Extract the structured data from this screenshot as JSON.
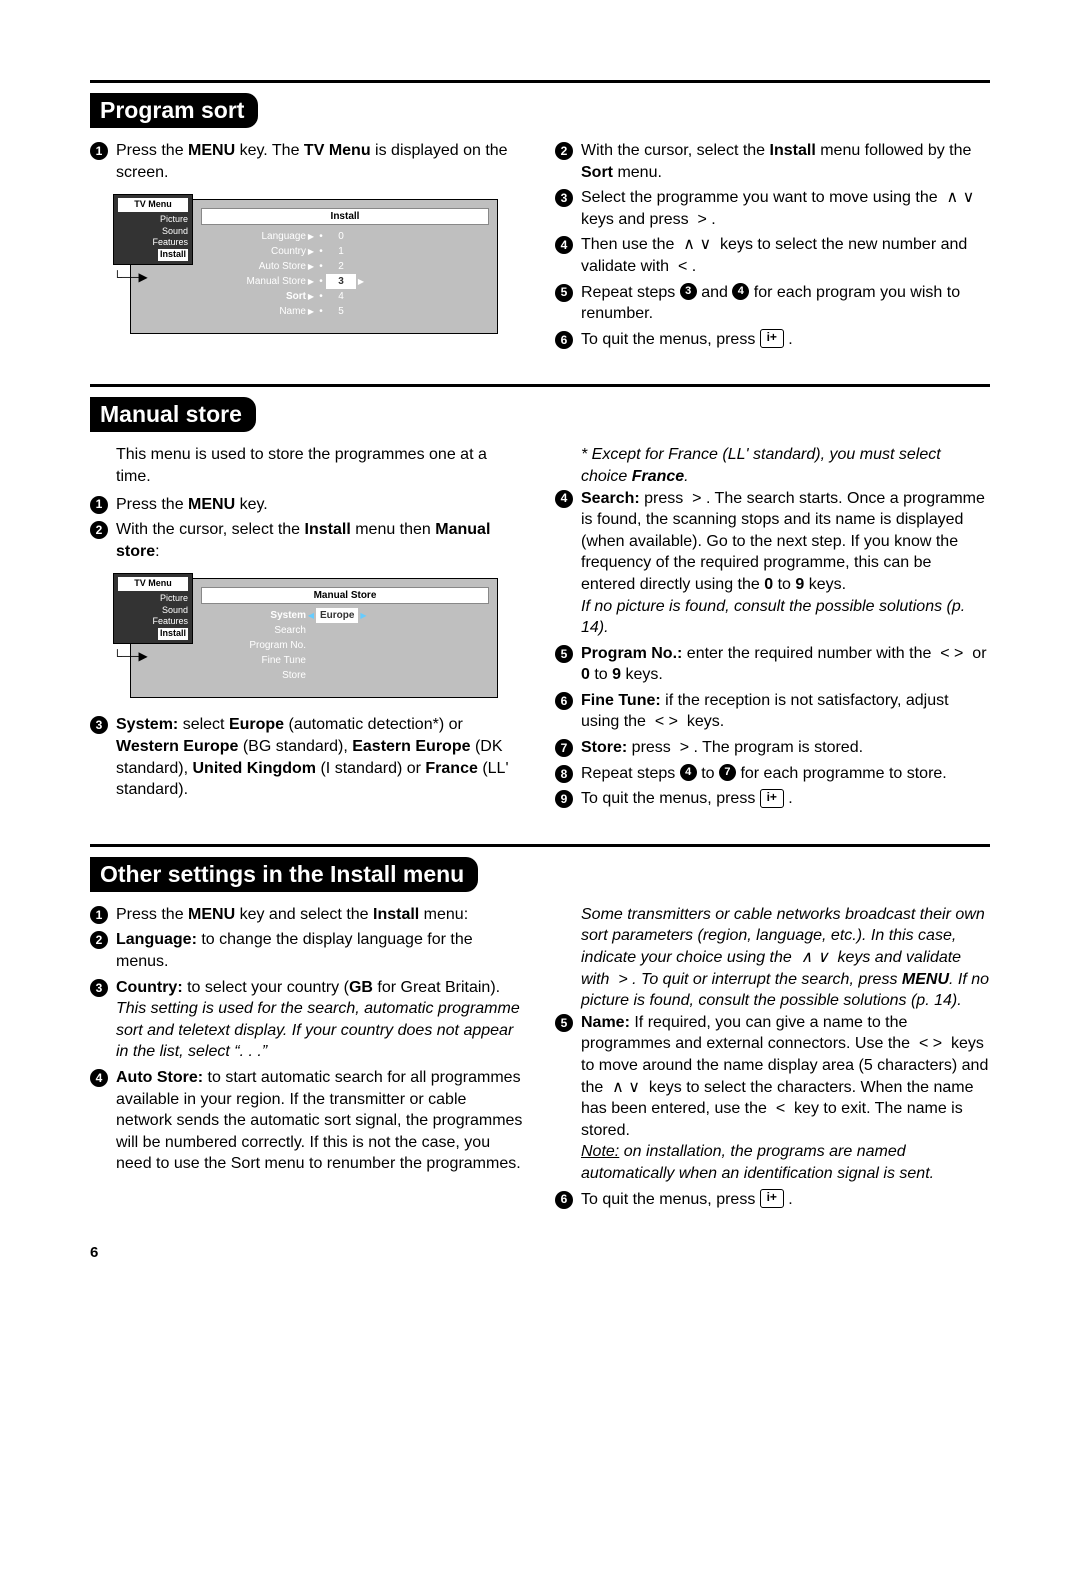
{
  "page_number": "6",
  "section1": {
    "title": "Program sort",
    "left": {
      "s1": "Press the <b>MENU</b> key. The <b>TV Menu</b> is displayed on the screen."
    },
    "right": {
      "s2": "With the cursor, select the <b>Install</b> menu followed by the <b>Sort</b> menu.",
      "s3": "Select the programme you want to move using the &nbsp;∧ ∨&nbsp; keys and press &nbsp;>&nbsp;.",
      "s4": "Then use the &nbsp;∧ ∨&nbsp; keys to select the new number and validate with &nbsp;<&nbsp;.",
      "s5_a": "Repeat steps ",
      "s5_b": " and ",
      "s5_c": " for each program you wish to renumber.",
      "s6_a": "To quit the menus, press ",
      "s6_key": "i+",
      "s6_b": "."
    },
    "diagram": {
      "left_tab_hdr": "TV Menu",
      "left_items": [
        "Picture",
        "Sound",
        "Features"
      ],
      "left_hl": "Install",
      "panel_hdr": "Install",
      "rows": [
        {
          "lab": "Language",
          "val": "0"
        },
        {
          "lab": "Country",
          "val": "1"
        },
        {
          "lab": "Auto Store",
          "val": "2"
        },
        {
          "lab": "Manual Store",
          "val": "3",
          "hl": true
        },
        {
          "lab": "Sort",
          "val": "4",
          "bold": true
        },
        {
          "lab": "Name",
          "val": "5"
        }
      ]
    }
  },
  "section2": {
    "title": "Manual store",
    "intro": "This menu is used to store the programmes one at a time.",
    "left": {
      "s1": "Press the <b>MENU</b> key.",
      "s2": "With the cursor, select the <b>Install</b> menu then <b>Manual store</b>:",
      "s3": "<b>System:</b> select <b>Europe</b> (automatic detection*) or <b>Western Europe</b> (BG standard), <b>Eastern Europe</b> (DK standard), <b>United Kingdom</b> (I standard) or <b>France</b> (LL' standard)."
    },
    "italic_note": "* Except for France (LL' standard), you must select choice <b>France</b>.",
    "right": {
      "s4": "<b>Search:</b> press &nbsp;>&nbsp;. The search starts. Once a programme is found, the scanning stops and its name is displayed (when available). Go to the next step. If you know the frequency of the required programme, this can be entered directly using the <b>0</b> to <b>9</b> keys.",
      "s4_note": "If no picture is found, consult the possible solutions (p. 14).",
      "s5": "<b>Program No.:</b> enter the required number with the &nbsp;< >&nbsp; or <b>0</b> to <b>9</b> keys.",
      "s6": "<b>Fine Tune:</b> if the reception is not satisfactory, adjust using the &nbsp;< >&nbsp; keys.",
      "s7": "<b>Store:</b> press &nbsp;>&nbsp;. The program is stored.",
      "s8_a": "Repeat steps ",
      "s8_b": " to ",
      "s8_c": " for each programme to store.",
      "s9_a": "To quit the menus, press ",
      "s9_key": "i+",
      "s9_b": "."
    },
    "diagram": {
      "left_tab_hdr": "TV Menu",
      "left_items": [
        "Picture",
        "Sound",
        "Features"
      ],
      "left_hl": "Install",
      "panel_hdr": "Manual Store",
      "rows": [
        {
          "lab": "System",
          "val": "Europe",
          "hl": true
        },
        {
          "lab": "Search"
        },
        {
          "lab": "Program No."
        },
        {
          "lab": "Fine Tune"
        },
        {
          "lab": "Store"
        }
      ]
    }
  },
  "section3": {
    "title": "Other settings in the Install menu",
    "left": {
      "s1": "Press the <b>MENU</b> key and select the <b>Install</b> menu:",
      "s2": "<b>Language:</b> to change the display language for the menus.",
      "s3": "<b>Country:</b> to select your country (<b>GB</b> for Great Britain).",
      "s3_note": "This setting is used for the search, automatic programme sort and teletext display. If your country does not appear in the list, select “. . .”",
      "s4": "<b>Auto Store:</b> to start automatic search for all programmes available in your region. If the transmitter or cable network sends the automatic sort signal, the programmes will be numbered correctly. If this is not the case, you need to use the Sort menu to renumber the programmes."
    },
    "right_note": "Some transmitters or cable networks broadcast their own sort parameters (region, language, etc.). In this case, indicate your choice using the &nbsp;∧ ∨&nbsp; keys and validate with &nbsp;>&nbsp;. To quit or interrupt the search, press <b>MENU</b>. If no picture is found, consult the possible solutions (p. 14).",
    "right": {
      "s5": "<b>Name:</b> If required, you can give a name to the programmes and external connectors. Use the &nbsp;< >&nbsp; keys to move around the name display area (5 characters) and the &nbsp;∧ ∨&nbsp; keys to select the characters. When the name has been entered, use the &nbsp;<&nbsp; key to exit. The name is stored.",
      "s5_note": "<span class='under'>Note:</span> on installation, the programs are named automatically when an identification signal is sent.",
      "s6_a": "To quit the menus, press ",
      "s6_key": "i+",
      "s6_b": "."
    }
  }
}
